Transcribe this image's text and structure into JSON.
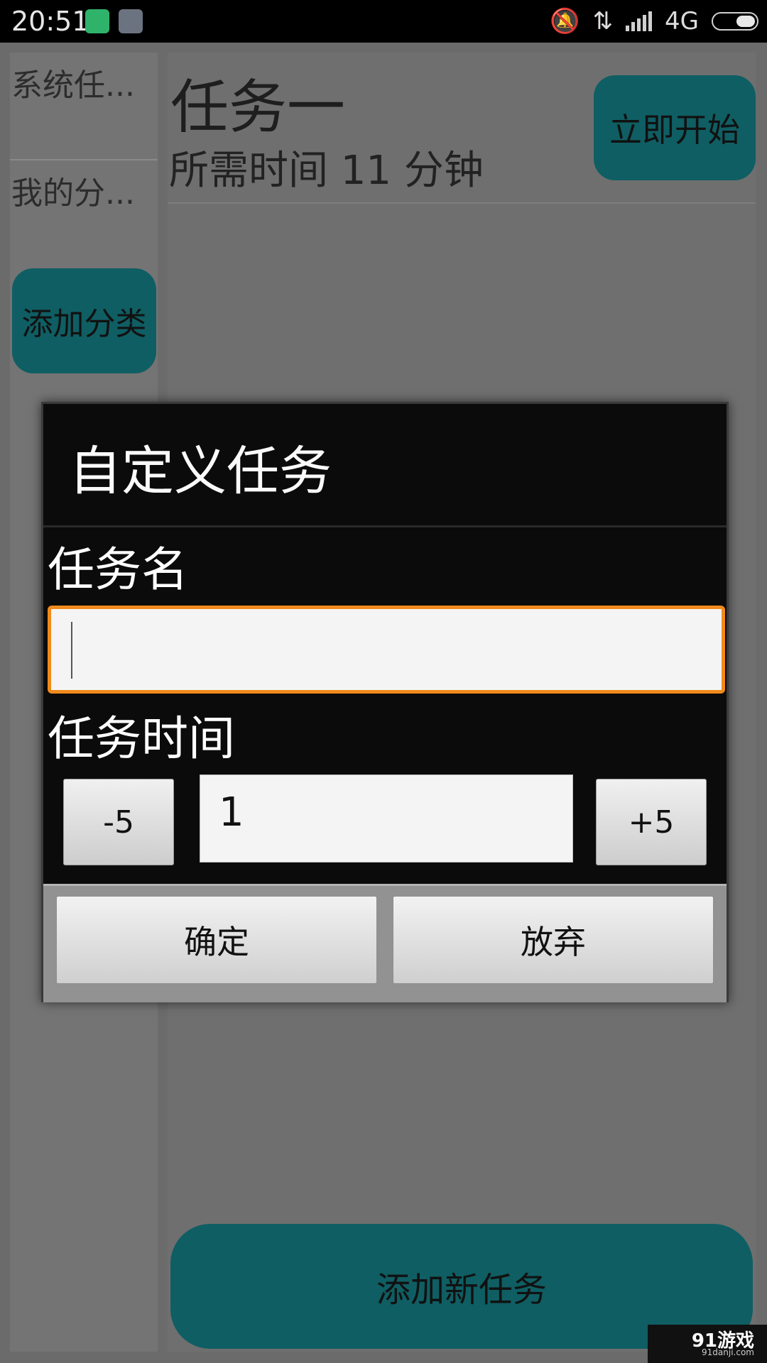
{
  "status_bar": {
    "time": "20:51",
    "network": "4G",
    "icons": [
      "shield-app-icon",
      "scissors-app-icon",
      "mute-bell-icon",
      "data-arrows-icon",
      "signal-icon",
      "battery-icon"
    ]
  },
  "categories": {
    "items": [
      {
        "label": "系统任..."
      },
      {
        "label": "我的分..."
      }
    ],
    "add_button": "添加分类"
  },
  "task": {
    "title": "任务一",
    "duration_text": "所需时间  11 分钟",
    "start_button": "立即开始"
  },
  "add_task_button": "添加新任务",
  "dialog": {
    "title": "自定义任务",
    "name_label": "任务名",
    "name_value": "",
    "time_label": "任务时间",
    "minus_button": "-5",
    "time_value": "1",
    "plus_button": "+5",
    "ok_button": "确定",
    "cancel_button": "放弃"
  },
  "watermark": {
    "main": "91游戏",
    "sub": "91danji.com"
  },
  "colors": {
    "teal_button": "#0f5e63",
    "focus_border": "#f08a1c",
    "dialog_bg": "#0b0b0b"
  }
}
